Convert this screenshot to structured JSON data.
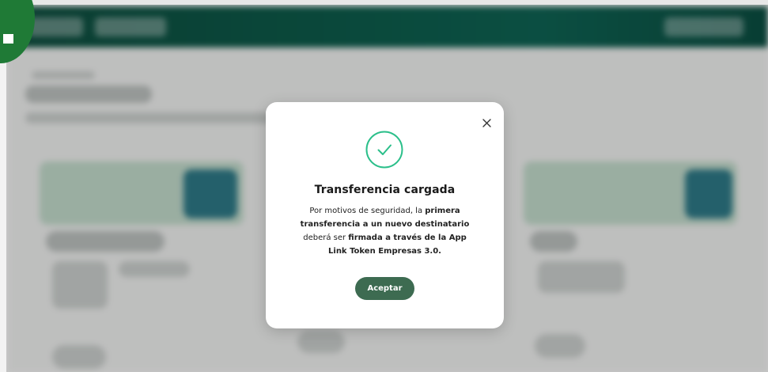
{
  "modal": {
    "title": "Transferencia cargada",
    "body": {
      "part1": "Por motivos de seguridad, la ",
      "bold1": "primera transferencia a un nuevo destinatario",
      "part2": " deberá ser ",
      "bold2": "firmada a través de la App Link Token Empresas 3.0."
    },
    "accept_label": "Aceptar",
    "close_icon": "close-icon",
    "status_icon": "check-circle-icon"
  },
  "colors": {
    "accent": "#3d6b51",
    "success": "#2bbf8a",
    "header": "#0f5c4b",
    "badge": "#1f7a36"
  }
}
